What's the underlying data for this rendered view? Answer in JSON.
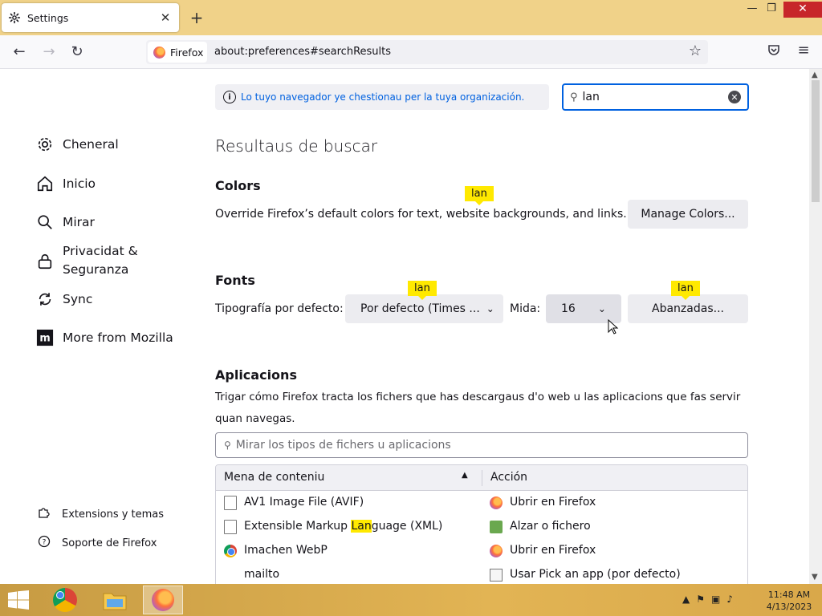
{
  "tab": {
    "title": "Settings"
  },
  "window": {
    "min": "—",
    "max": "❐",
    "close": "✕"
  },
  "nav": {
    "identity_label": "Firefox",
    "url": "about:preferences#searchResults"
  },
  "sidebar": {
    "items": [
      {
        "label": "Cheneral",
        "icon": "gear-icon"
      },
      {
        "label": "Inicio",
        "icon": "home-icon"
      },
      {
        "label": "Mirar",
        "icon": "search-icon"
      },
      {
        "label": "Privacidat & Seguranza",
        "icon": "lock-icon"
      },
      {
        "label": "Sync",
        "icon": "sync-icon"
      },
      {
        "label": "More from Mozilla",
        "icon": "mozilla-icon"
      }
    ],
    "footer": [
      {
        "label": "Extensions y temas",
        "icon": "puzzle-icon"
      },
      {
        "label": "Soporte de Firefox",
        "icon": "help-icon"
      }
    ]
  },
  "policy_notice": "Lo tuyo navegador ye chestionau per la tuya organización.",
  "search": {
    "value": "lan"
  },
  "results_heading": "Resultaus de buscar",
  "colors": {
    "title": "Colors",
    "description": "Override Firefox’s default colors for text, website backgrounds, and links.",
    "button": "Manage Colors...",
    "tooltip": "lan"
  },
  "fonts": {
    "title": "Fonts",
    "default_font_label": "Tipografía por defecto:",
    "default_font_value": "Por defecto (Times ...",
    "size_label": "Mida:",
    "size_value": "16",
    "advanced_button": "Abanzadas...",
    "tooltip": "lan"
  },
  "applications": {
    "title": "Aplicacions",
    "description_line1": "Trigar cómo Firefox tracta los fichers que has descargaus d'o web u las aplicacions que fas servir",
    "description_line2": "quan navegas.",
    "search_placeholder": "Mirar los tipos de fichers u aplicacions",
    "columns": {
      "type": "Mena de conteniu",
      "action": "Acción"
    },
    "rows": [
      {
        "type": "AV1 Image File (AVIF)",
        "action": "Ubrir en Firefox"
      },
      {
        "type_pre": "Extensible Markup ",
        "type_hl": "Lan",
        "type_post": "guage (XML)",
        "action": "Alzar o fichero"
      },
      {
        "type": "Imachen WebP",
        "action": "Ubrir en Firefox"
      },
      {
        "type": "mailto",
        "action": "Usar Pick an app (por defecto)"
      }
    ]
  },
  "taskbar": {
    "time": "11:48 AM",
    "date": "4/13/2023"
  }
}
